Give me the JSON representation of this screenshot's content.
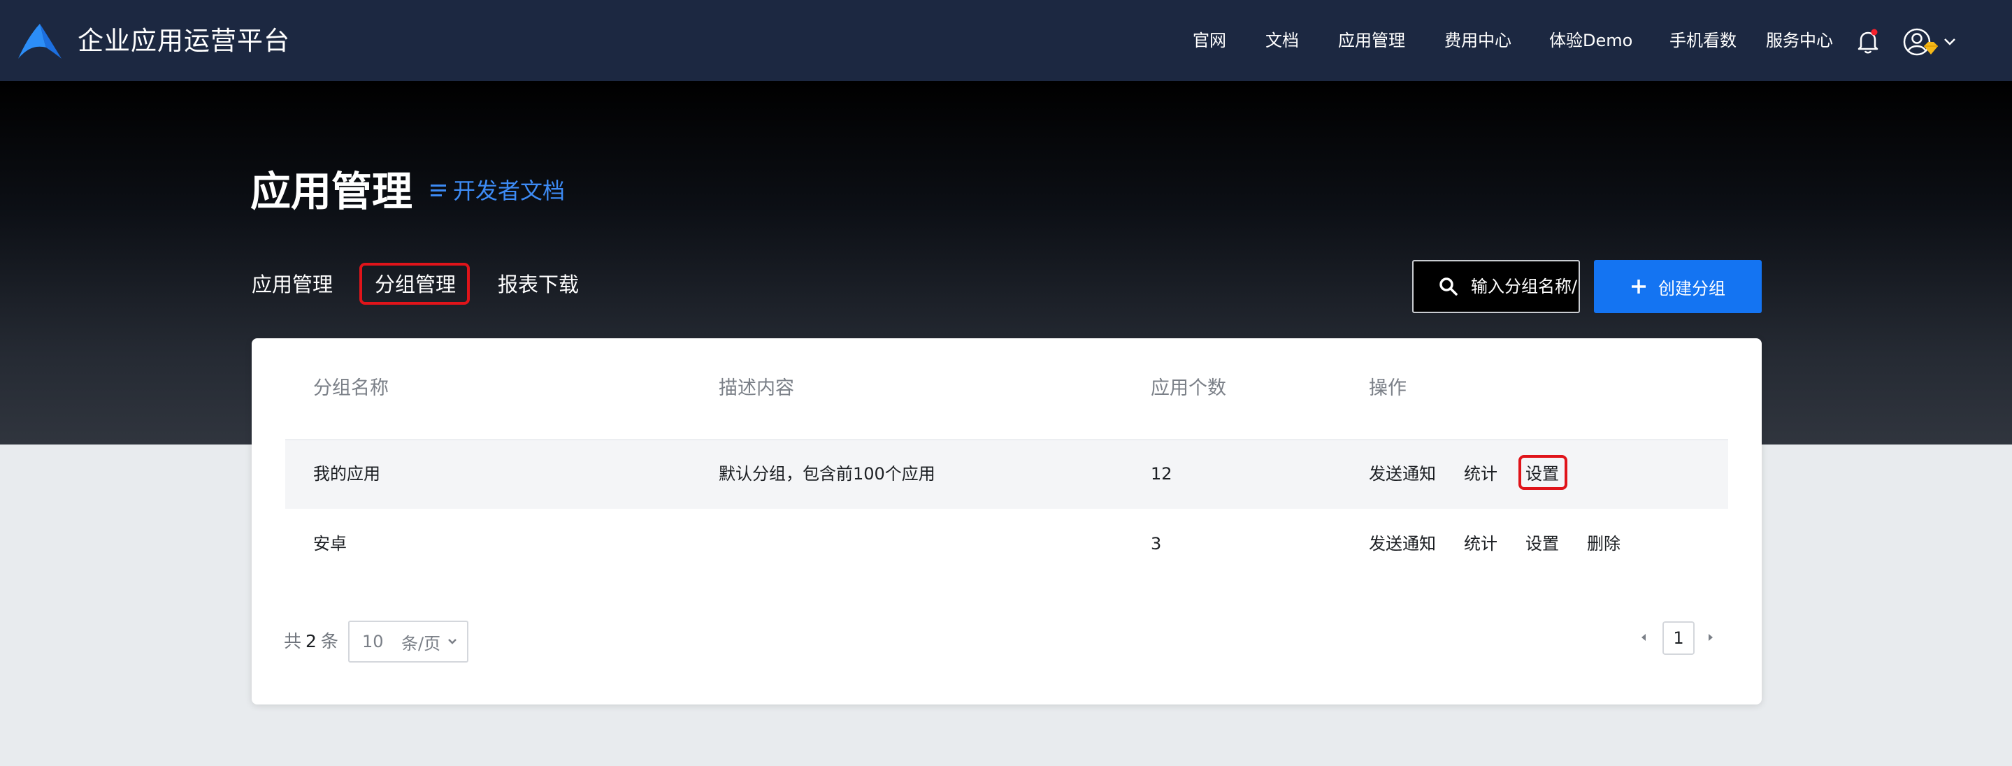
{
  "header": {
    "brand": "企业应用运营平台",
    "nav": [
      "官网",
      "文档",
      "应用管理",
      "费用中心",
      "体验Demo",
      "手机看数",
      "服务中心"
    ]
  },
  "page": {
    "title": "应用管理",
    "doc_link": "开发者文档",
    "tabs": [
      "应用管理",
      "分组管理",
      "报表下载"
    ],
    "active_tab": "分组管理",
    "search_placeholder": "输入分组名称/",
    "create_button": "创建分组"
  },
  "table": {
    "columns": [
      "分组名称",
      "描述内容",
      "应用个数",
      "操作"
    ],
    "rows": [
      {
        "name": "我的应用",
        "desc": "默认分组，包含前100个应用",
        "count": "12",
        "actions": [
          "发送通知",
          "统计",
          "设置"
        ]
      },
      {
        "name": "安卓",
        "desc": "",
        "count": "3",
        "actions": [
          "发送通知",
          "统计",
          "设置",
          "删除"
        ]
      }
    ]
  },
  "pagination": {
    "total_prefix": "共",
    "total": "2",
    "total_suffix": "条",
    "page_size": "10",
    "page_size_unit": "条/页",
    "current_page": "1"
  },
  "colors": {
    "topbar": "#1c2841",
    "accent": "#1474f2",
    "link": "#3d8bf5",
    "highlight": "#e0141a"
  },
  "icons": [
    "logo-icon",
    "bell-icon",
    "avatar-icon",
    "vip-diamond-icon",
    "chevron-down-icon",
    "doc-list-icon",
    "search-icon",
    "plus-icon",
    "chevron-left-icon",
    "chevron-right-icon"
  ]
}
